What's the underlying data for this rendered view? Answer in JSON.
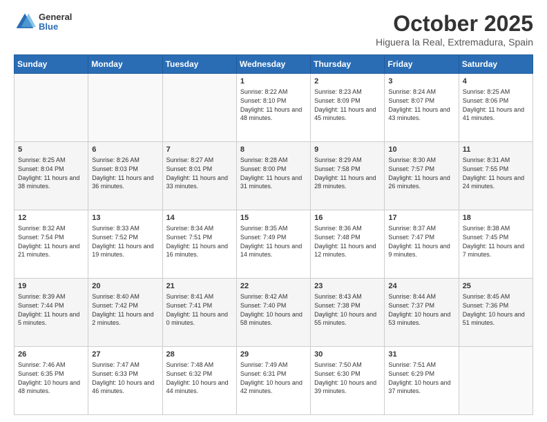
{
  "header": {
    "logo": {
      "general": "General",
      "blue": "Blue"
    },
    "title": "October 2025",
    "subtitle": "Higuera la Real, Extremadura, Spain"
  },
  "days_of_week": [
    "Sunday",
    "Monday",
    "Tuesday",
    "Wednesday",
    "Thursday",
    "Friday",
    "Saturday"
  ],
  "weeks": [
    [
      {
        "day": "",
        "sunrise": "",
        "sunset": "",
        "daylight": ""
      },
      {
        "day": "",
        "sunrise": "",
        "sunset": "",
        "daylight": ""
      },
      {
        "day": "",
        "sunrise": "",
        "sunset": "",
        "daylight": ""
      },
      {
        "day": "1",
        "sunrise": "Sunrise: 8:22 AM",
        "sunset": "Sunset: 8:10 PM",
        "daylight": "Daylight: 11 hours and 48 minutes."
      },
      {
        "day": "2",
        "sunrise": "Sunrise: 8:23 AM",
        "sunset": "Sunset: 8:09 PM",
        "daylight": "Daylight: 11 hours and 45 minutes."
      },
      {
        "day": "3",
        "sunrise": "Sunrise: 8:24 AM",
        "sunset": "Sunset: 8:07 PM",
        "daylight": "Daylight: 11 hours and 43 minutes."
      },
      {
        "day": "4",
        "sunrise": "Sunrise: 8:25 AM",
        "sunset": "Sunset: 8:06 PM",
        "daylight": "Daylight: 11 hours and 41 minutes."
      }
    ],
    [
      {
        "day": "5",
        "sunrise": "Sunrise: 8:25 AM",
        "sunset": "Sunset: 8:04 PM",
        "daylight": "Daylight: 11 hours and 38 minutes."
      },
      {
        "day": "6",
        "sunrise": "Sunrise: 8:26 AM",
        "sunset": "Sunset: 8:03 PM",
        "daylight": "Daylight: 11 hours and 36 minutes."
      },
      {
        "day": "7",
        "sunrise": "Sunrise: 8:27 AM",
        "sunset": "Sunset: 8:01 PM",
        "daylight": "Daylight: 11 hours and 33 minutes."
      },
      {
        "day": "8",
        "sunrise": "Sunrise: 8:28 AM",
        "sunset": "Sunset: 8:00 PM",
        "daylight": "Daylight: 11 hours and 31 minutes."
      },
      {
        "day": "9",
        "sunrise": "Sunrise: 8:29 AM",
        "sunset": "Sunset: 7:58 PM",
        "daylight": "Daylight: 11 hours and 28 minutes."
      },
      {
        "day": "10",
        "sunrise": "Sunrise: 8:30 AM",
        "sunset": "Sunset: 7:57 PM",
        "daylight": "Daylight: 11 hours and 26 minutes."
      },
      {
        "day": "11",
        "sunrise": "Sunrise: 8:31 AM",
        "sunset": "Sunset: 7:55 PM",
        "daylight": "Daylight: 11 hours and 24 minutes."
      }
    ],
    [
      {
        "day": "12",
        "sunrise": "Sunrise: 8:32 AM",
        "sunset": "Sunset: 7:54 PM",
        "daylight": "Daylight: 11 hours and 21 minutes."
      },
      {
        "day": "13",
        "sunrise": "Sunrise: 8:33 AM",
        "sunset": "Sunset: 7:52 PM",
        "daylight": "Daylight: 11 hours and 19 minutes."
      },
      {
        "day": "14",
        "sunrise": "Sunrise: 8:34 AM",
        "sunset": "Sunset: 7:51 PM",
        "daylight": "Daylight: 11 hours and 16 minutes."
      },
      {
        "day": "15",
        "sunrise": "Sunrise: 8:35 AM",
        "sunset": "Sunset: 7:49 PM",
        "daylight": "Daylight: 11 hours and 14 minutes."
      },
      {
        "day": "16",
        "sunrise": "Sunrise: 8:36 AM",
        "sunset": "Sunset: 7:48 PM",
        "daylight": "Daylight: 11 hours and 12 minutes."
      },
      {
        "day": "17",
        "sunrise": "Sunrise: 8:37 AM",
        "sunset": "Sunset: 7:47 PM",
        "daylight": "Daylight: 11 hours and 9 minutes."
      },
      {
        "day": "18",
        "sunrise": "Sunrise: 8:38 AM",
        "sunset": "Sunset: 7:45 PM",
        "daylight": "Daylight: 11 hours and 7 minutes."
      }
    ],
    [
      {
        "day": "19",
        "sunrise": "Sunrise: 8:39 AM",
        "sunset": "Sunset: 7:44 PM",
        "daylight": "Daylight: 11 hours and 5 minutes."
      },
      {
        "day": "20",
        "sunrise": "Sunrise: 8:40 AM",
        "sunset": "Sunset: 7:42 PM",
        "daylight": "Daylight: 11 hours and 2 minutes."
      },
      {
        "day": "21",
        "sunrise": "Sunrise: 8:41 AM",
        "sunset": "Sunset: 7:41 PM",
        "daylight": "Daylight: 11 hours and 0 minutes."
      },
      {
        "day": "22",
        "sunrise": "Sunrise: 8:42 AM",
        "sunset": "Sunset: 7:40 PM",
        "daylight": "Daylight: 10 hours and 58 minutes."
      },
      {
        "day": "23",
        "sunrise": "Sunrise: 8:43 AM",
        "sunset": "Sunset: 7:38 PM",
        "daylight": "Daylight: 10 hours and 55 minutes."
      },
      {
        "day": "24",
        "sunrise": "Sunrise: 8:44 AM",
        "sunset": "Sunset: 7:37 PM",
        "daylight": "Daylight: 10 hours and 53 minutes."
      },
      {
        "day": "25",
        "sunrise": "Sunrise: 8:45 AM",
        "sunset": "Sunset: 7:36 PM",
        "daylight": "Daylight: 10 hours and 51 minutes."
      }
    ],
    [
      {
        "day": "26",
        "sunrise": "Sunrise: 7:46 AM",
        "sunset": "Sunset: 6:35 PM",
        "daylight": "Daylight: 10 hours and 48 minutes."
      },
      {
        "day": "27",
        "sunrise": "Sunrise: 7:47 AM",
        "sunset": "Sunset: 6:33 PM",
        "daylight": "Daylight: 10 hours and 46 minutes."
      },
      {
        "day": "28",
        "sunrise": "Sunrise: 7:48 AM",
        "sunset": "Sunset: 6:32 PM",
        "daylight": "Daylight: 10 hours and 44 minutes."
      },
      {
        "day": "29",
        "sunrise": "Sunrise: 7:49 AM",
        "sunset": "Sunset: 6:31 PM",
        "daylight": "Daylight: 10 hours and 42 minutes."
      },
      {
        "day": "30",
        "sunrise": "Sunrise: 7:50 AM",
        "sunset": "Sunset: 6:30 PM",
        "daylight": "Daylight: 10 hours and 39 minutes."
      },
      {
        "day": "31",
        "sunrise": "Sunrise: 7:51 AM",
        "sunset": "Sunset: 6:29 PM",
        "daylight": "Daylight: 10 hours and 37 minutes."
      },
      {
        "day": "",
        "sunrise": "",
        "sunset": "",
        "daylight": ""
      }
    ]
  ]
}
